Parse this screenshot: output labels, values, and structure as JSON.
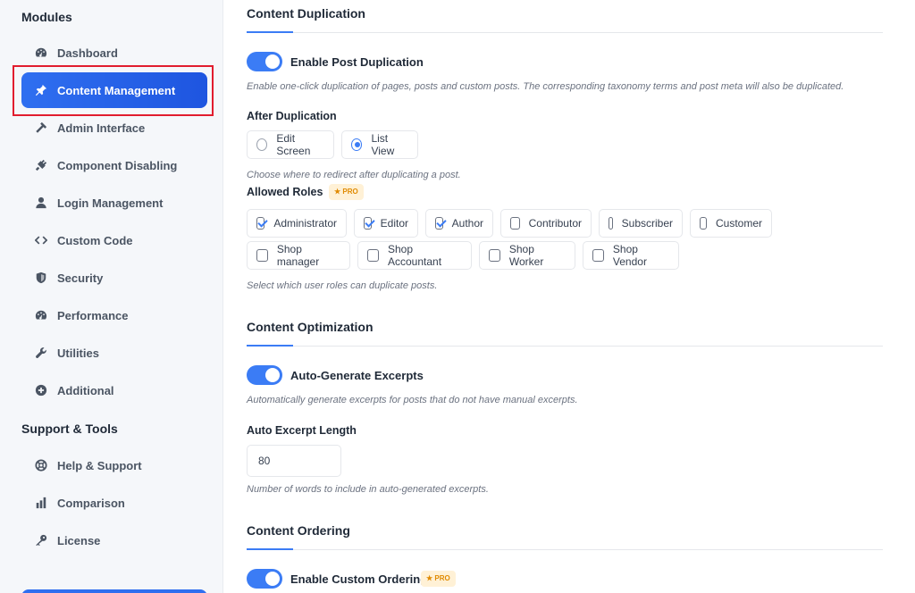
{
  "sidebar": {
    "modules_title": "Modules",
    "items": [
      {
        "label": "Dashboard",
        "icon": "gauge-icon"
      },
      {
        "label": "Content Management",
        "icon": "pin-icon"
      },
      {
        "label": "Admin Interface",
        "icon": "hammer-icon"
      },
      {
        "label": "Component Disabling",
        "icon": "plug-icon"
      },
      {
        "label": "Login Management",
        "icon": "user-icon"
      },
      {
        "label": "Custom Code",
        "icon": "code-icon"
      },
      {
        "label": "Security",
        "icon": "shield-icon"
      },
      {
        "label": "Performance",
        "icon": "gauge-icon"
      },
      {
        "label": "Utilities",
        "icon": "wrench-icon"
      },
      {
        "label": "Additional",
        "icon": "plus-circle-icon"
      }
    ],
    "support_title": "Support & Tools",
    "support_items": [
      {
        "label": "Help & Support",
        "icon": "lifebuoy-icon"
      },
      {
        "label": "Comparison",
        "icon": "bar-chart-icon"
      },
      {
        "label": "License",
        "icon": "key-icon"
      }
    ],
    "active_index": 1,
    "accent": "#2f6ff0"
  },
  "main": {
    "duplication": {
      "title": "Content Duplication",
      "toggle_label": "Enable Post Duplication",
      "toggle_on": true,
      "toggle_desc": "Enable one-click duplication of pages, posts and custom posts. The corresponding taxonomy terms and post meta will also be duplicated.",
      "after_label": "After Duplication",
      "options": [
        "Edit Screen",
        "List View"
      ],
      "selected_option": "List View",
      "after_desc": "Choose where to redirect after duplicating a post.",
      "roles_label": "Allowed Roles",
      "pro_badge": "★ PRO",
      "roles": [
        {
          "label": "Administrator",
          "checked": true
        },
        {
          "label": "Editor",
          "checked": true
        },
        {
          "label": "Author",
          "checked": true
        },
        {
          "label": "Contributor",
          "checked": false
        },
        {
          "label": "Subscriber",
          "checked": false
        },
        {
          "label": "Customer",
          "checked": false
        },
        {
          "label": "Shop manager",
          "checked": false
        },
        {
          "label": "Shop Accountant",
          "checked": false
        },
        {
          "label": "Shop Worker",
          "checked": false
        },
        {
          "label": "Shop Vendor",
          "checked": false
        }
      ],
      "roles_desc": "Select which user roles can duplicate posts."
    },
    "optimization": {
      "title": "Content Optimization",
      "toggle_label": "Auto-Generate Excerpts",
      "toggle_on": true,
      "toggle_desc": "Automatically generate excerpts for posts that do not have manual excerpts.",
      "length_label": "Auto Excerpt Length",
      "length_value": "80",
      "length_desc": "Number of words to include in auto-generated excerpts."
    },
    "ordering": {
      "title": "Content Ordering",
      "toggle_label": "Enable Custom Ordering",
      "toggle_on": true,
      "pro_badge": "★ PRO"
    }
  }
}
